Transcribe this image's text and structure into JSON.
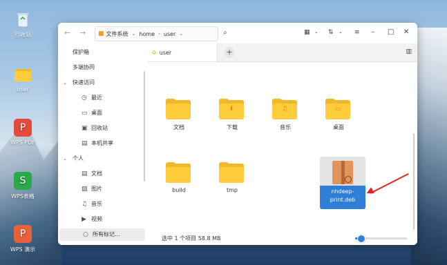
{
  "desktop": {
    "icons": [
      {
        "label": "回收站",
        "icon": "trash-icon"
      },
      {
        "label": "user",
        "icon": "folder-icon"
      },
      {
        "label": "WPS PDF",
        "icon": "wps-pdf-icon"
      },
      {
        "label": "WPS表格",
        "icon": "wps-sheet-icon"
      },
      {
        "label": "WPS 演示",
        "icon": "wps-slides-icon"
      }
    ]
  },
  "titlebar": {
    "path": [
      "文件系统",
      "home",
      "user"
    ]
  },
  "sidebar": {
    "items": [
      {
        "label": "保护箱"
      },
      {
        "label": "多端协同"
      },
      {
        "label": "快速访问"
      },
      {
        "label": "最近"
      },
      {
        "label": "桌面"
      },
      {
        "label": "回收站"
      },
      {
        "label": "本机共享"
      },
      {
        "label": "个人"
      },
      {
        "label": "文档"
      },
      {
        "label": "图片"
      },
      {
        "label": "音乐"
      },
      {
        "label": "视频"
      },
      {
        "label": "所有标记..."
      }
    ]
  },
  "tabs": [
    {
      "label": "user"
    }
  ],
  "files": [
    {
      "name": "文档",
      "glyph": ""
    },
    {
      "name": "下载",
      "glyph": "⬇"
    },
    {
      "name": "音乐",
      "glyph": "♫"
    },
    {
      "name": "桌面",
      "glyph": "▭"
    },
    {
      "name": "build",
      "glyph": ""
    },
    {
      "name": "tmp",
      "glyph": ""
    },
    {
      "name_line1": "nhdeep-",
      "name_line2": "print.deb"
    }
  ],
  "status": {
    "selection": "选中 1 个项目  58.8 MB",
    "zoom_fraction": 0.1
  },
  "colors": {
    "accent": "#2f7fd8",
    "folder": "#ffcc3c",
    "annotation_arrow": "#e02424"
  }
}
